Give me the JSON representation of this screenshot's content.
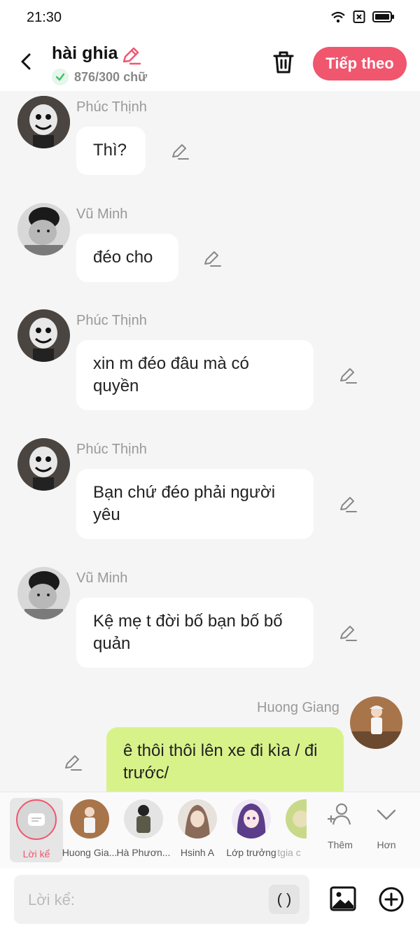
{
  "status": {
    "time": "21:30"
  },
  "header": {
    "title": "hài ghia",
    "counter": "876/300 chữ",
    "next_label": "Tiếp theo"
  },
  "messages": [
    {
      "sender": "Phúc Thịnh",
      "text": "Thì?",
      "side": "left",
      "avatar": "cartoon-face-avatar"
    },
    {
      "sender": "Vũ Minh",
      "text": "đéo cho",
      "side": "left",
      "avatar": "boy-photo-avatar"
    },
    {
      "sender": "Phúc Thịnh",
      "text": "xin m đéo đâu mà có quyền",
      "side": "left",
      "avatar": "cartoon-face-avatar"
    },
    {
      "sender": "Phúc Thịnh",
      "text": "Bạn chứ đéo phải người yêu",
      "side": "left",
      "avatar": "cartoon-face-avatar"
    },
    {
      "sender": "Vũ Minh",
      "text": "Kệ mẹ t đời bố bạn bố bố quản",
      "side": "left",
      "avatar": "boy-photo-avatar"
    },
    {
      "sender": "Huong Giang",
      "text": "ê thôi thôi lên xe đi kìa / đi trước/",
      "side": "right",
      "avatar": "girl-photo-avatar"
    }
  ],
  "characters": [
    {
      "name": "Lời kể",
      "active": true
    },
    {
      "name": "Huong Gia..."
    },
    {
      "name": "Hà Phươn..."
    },
    {
      "name": "Hsinh A"
    },
    {
      "name": "Lớp trưởng"
    },
    {
      "name": "tgia c"
    }
  ],
  "tools": {
    "add_label": "Thêm",
    "more_label": "Hơn"
  },
  "input": {
    "placeholder": "Lời kể:",
    "paren_label": "( )"
  },
  "colors": {
    "accent": "#f0566e",
    "my_bubble": "#d8f28a",
    "check_green": "#3cc26a"
  }
}
